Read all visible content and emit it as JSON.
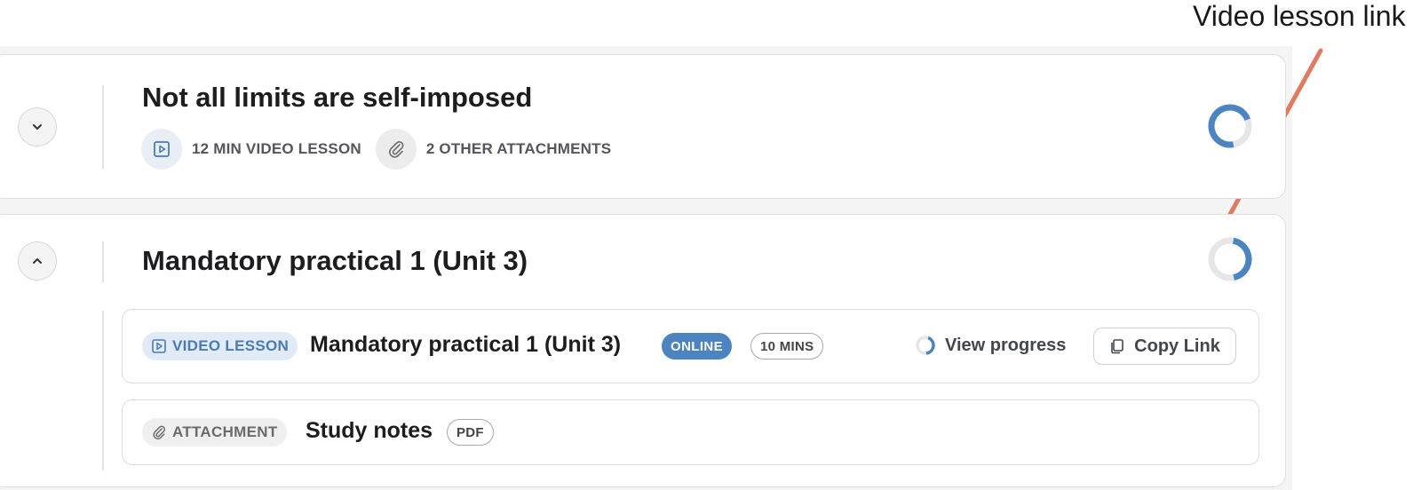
{
  "annotation": {
    "label": "Video lesson link",
    "arrow_color": "#e07a60"
  },
  "sections": [
    {
      "title": "Not all limits are self-imposed",
      "toggle_icon": "chevron-down-icon",
      "meta": [
        {
          "icon": "play-icon",
          "text": "12 MIN VIDEO LESSON"
        },
        {
          "icon": "paperclip-icon",
          "text": "2 OTHER ATTACHMENTS"
        }
      ],
      "progress_icon": "progress-ring-icon"
    },
    {
      "title": "Mandatory practical 1 (Unit 3)",
      "toggle_icon": "chevron-up-icon",
      "progress_icon": "progress-ring-icon",
      "items": [
        {
          "type_label": "VIDEO LESSON",
          "type_icon": "play-icon",
          "title": "Mandatory practical 1 (Unit 3)",
          "status_badge": "ONLINE",
          "duration_badge": "10 MINS",
          "view_progress_label": "View progress",
          "copy_link_label": "Copy Link"
        },
        {
          "type_label": "ATTACHMENT",
          "type_icon": "paperclip-icon",
          "title": "Study notes",
          "format_badge": "PDF"
        }
      ]
    }
  ],
  "colors": {
    "accent_blue": "#4c84c2",
    "ring_track": "#e6e6e6",
    "video_pill_bg": "#e1ebf6",
    "attachment_pill_bg": "#efefef"
  }
}
